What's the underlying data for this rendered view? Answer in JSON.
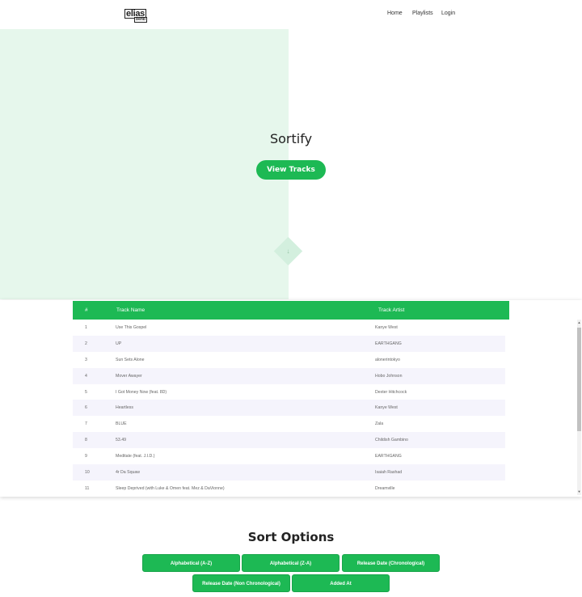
{
  "header": {
    "logo_main": "elias",
    "logo_sub": "benb",
    "nav": [
      "Home",
      "Playlists",
      "Login"
    ]
  },
  "hero": {
    "title": "Sortify",
    "button_label": "View Tracks",
    "scroll_icon": "arrow-down-icon"
  },
  "table": {
    "headers": [
      "#",
      "Track Name",
      "Track Artist"
    ],
    "rows": [
      {
        "num": "1",
        "name": "Use This Gospel",
        "artist": "Kanye West"
      },
      {
        "num": "2",
        "name": "UP",
        "artist": "EARTHGANG"
      },
      {
        "num": "3",
        "name": "Sun Sets Alone",
        "artist": "alonerintokyo"
      },
      {
        "num": "4",
        "name": "Mover Awayer",
        "artist": "Hobo Johnson"
      },
      {
        "num": "5",
        "name": "I Got Money Now (feat. 8D)",
        "artist": "Dexter Hitchcock"
      },
      {
        "num": "6",
        "name": "Heartless",
        "artist": "Kanye West"
      },
      {
        "num": "7",
        "name": "BLUE",
        "artist": "Zala"
      },
      {
        "num": "8",
        "name": "53.49",
        "artist": "Childish Gambino"
      },
      {
        "num": "9",
        "name": "Meditate (feat. J.I.D.)",
        "artist": "EARTHGANG"
      },
      {
        "num": "10",
        "name": "4r Da Squaw",
        "artist": "Isaiah Rashad"
      },
      {
        "num": "11",
        "name": "Sleep Deprived (with Luke & Omen feat. Mez & DaVionne)",
        "artist": "Dreamville"
      }
    ]
  },
  "sort": {
    "title": "Sort Options",
    "buttons": [
      "Alphabetical (A-Z)",
      "Alphabetical (Z-A)",
      "Release Date (Chronological)",
      "Release Date (Non Chronological)",
      "Added At"
    ]
  },
  "colors": {
    "accent": "#1db954",
    "hero_bg": "#e6f7ec",
    "row_alt": "#f5f4fc"
  }
}
